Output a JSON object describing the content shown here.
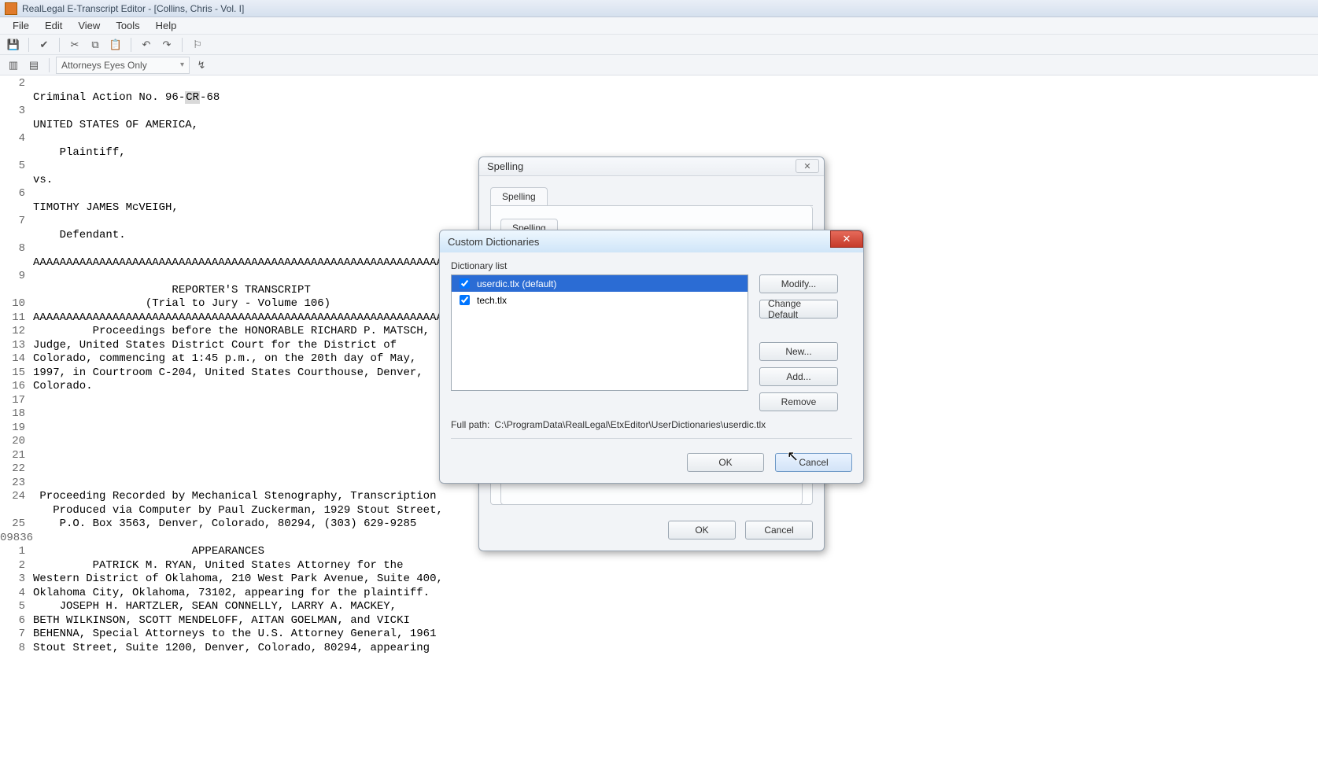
{
  "title": "RealLegal E-Transcript Editor - [Collins, Chris - Vol. I]",
  "menu": {
    "file": "File",
    "edit": "Edit",
    "view": "View",
    "tools": "Tools",
    "help": "Help"
  },
  "combo_label": "Attorneys Eyes Only",
  "lines": [
    {
      "n": "2",
      "t": ""
    },
    {
      "n": "",
      "t": "Criminal Action No. 96-",
      "hl": "CR",
      "after": "-68"
    },
    {
      "n": "3",
      "t": ""
    },
    {
      "n": "",
      "t": "UNITED STATES OF AMERICA,"
    },
    {
      "n": "4",
      "t": ""
    },
    {
      "n": "",
      "t": "    Plaintiff,"
    },
    {
      "n": "5",
      "t": ""
    },
    {
      "n": "",
      "t": "vs."
    },
    {
      "n": "6",
      "t": ""
    },
    {
      "n": "",
      "t": "TIMOTHY JAMES McVEIGH,"
    },
    {
      "n": "7",
      "t": ""
    },
    {
      "n": "",
      "t": "    Defendant."
    },
    {
      "n": "8",
      "t": ""
    },
    {
      "n": "",
      "t": "AAAAAAAAAAAAAAAAAAAAAAAAAAAAAAAAAAAAAAAAAAAAAAAAAAAAAAAAAAAAAAAAA"
    },
    {
      "n": "9",
      "t": ""
    },
    {
      "n": "",
      "t": "                     REPORTER'S TRANSCRIPT"
    },
    {
      "n": "10",
      "t": "                 (Trial to Jury - Volume 106)"
    },
    {
      "n": "11",
      "t": "AAAAAAAAAAAAAAAAAAAAAAAAAAAAAAAAAAAAAAAAAAAAAAAAAAAAAAAAAAAAAAAAA"
    },
    {
      "n": "12",
      "t": "         Proceedings before the HONORABLE RICHARD P. MATSCH,"
    },
    {
      "n": "13",
      "t": "Judge, United States District Court for the District of"
    },
    {
      "n": "14",
      "t": "Colorado, commencing at 1:45 p.m., on the 20th day of May,"
    },
    {
      "n": "15",
      "t": "1997, in Courtroom C-204, United States Courthouse, Denver,"
    },
    {
      "n": "16",
      "t": "Colorado."
    },
    {
      "n": "17",
      "t": ""
    },
    {
      "n": "18",
      "t": ""
    },
    {
      "n": "19",
      "t": ""
    },
    {
      "n": "20",
      "t": ""
    },
    {
      "n": "21",
      "t": ""
    },
    {
      "n": "22",
      "t": ""
    },
    {
      "n": "23",
      "t": ""
    },
    {
      "n": "24",
      "t": " Proceeding Recorded by Mechanical Stenography, Transcription"
    },
    {
      "n": "",
      "t": "   Produced via Computer by Paul Zuckerman, 1929 Stout Street,"
    },
    {
      "n": "25",
      "t": "    P.O. Box 3563, Denver, Colorado, 80294, (303) 629-9285"
    },
    {
      "n": "09836",
      "t": ""
    },
    {
      "n": "1",
      "t": "                        APPEARANCES"
    },
    {
      "n": "2",
      "t": "         PATRICK M. RYAN, United States Attorney for the"
    },
    {
      "n": "3",
      "t": "Western District of Oklahoma, 210 West Park Avenue, Suite 400,"
    },
    {
      "n": "4",
      "t": "Oklahoma City, Oklahoma, 73102, appearing for the plaintiff."
    },
    {
      "n": "5",
      "t": "    JOSEPH H. HARTZLER, SEAN CONNELLY, LARRY A. MACKEY,"
    },
    {
      "n": "6",
      "t": "BETH WILKINSON, SCOTT MENDELOFF, AITAN GOELMAN, and VICKI"
    },
    {
      "n": "7",
      "t": "BEHENNA, Special Attorneys to the U.S. Attorney General, 1961"
    },
    {
      "n": "8",
      "t": "Stout Street, Suite 1200, Denver, Colorado, 80294, appearing"
    }
  ],
  "spelling": {
    "title": "Spelling",
    "tab": "Spelling",
    "tab2": "Spelling",
    "ok": "OK",
    "cancel": "Cancel"
  },
  "cd": {
    "title": "Custom Dictionaries",
    "group": "Dictionary list",
    "items": [
      {
        "label": "userdic.tlx (default)",
        "selected": true,
        "checked": true
      },
      {
        "label": "tech.tlx",
        "selected": false,
        "checked": true
      }
    ],
    "modify": "Modify...",
    "change_default": "Change Default",
    "new": "New...",
    "add": "Add...",
    "remove": "Remove",
    "fullpath_label": "Full path:",
    "fullpath_value": "C:\\ProgramData\\RealLegal\\EtxEditor\\UserDictionaries\\userdic.tlx",
    "ok": "OK",
    "cancel": "Cancel"
  }
}
